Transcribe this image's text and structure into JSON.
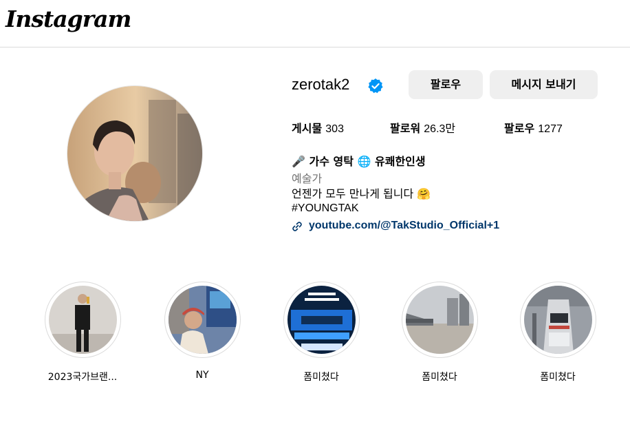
{
  "app": {
    "logo_text": "Instagram"
  },
  "profile": {
    "username": "zerotak2",
    "follow_label": "팔로우",
    "message_label": "메시지 보내기",
    "stats": [
      {
        "label": "게시물",
        "value": "303"
      },
      {
        "label": "팔로워",
        "value": "26.3만"
      },
      {
        "label": "팔로우",
        "value": "1277"
      }
    ],
    "bio": {
      "name": "🎤 가수 영탁 🌐 유쾌한인생",
      "category": "예술가",
      "line1": "언젠가 모두 만나게 됩니다 🤗",
      "hashtag": "#YOUNGTAK",
      "link": "youtube.com/@TakStudio_Official+1"
    }
  },
  "highlights": [
    {
      "label": "2023국가브랜..."
    },
    {
      "label": "NY"
    },
    {
      "label": "폼미쳤다"
    },
    {
      "label": "폼미쳤다"
    },
    {
      "label": "폼미쳤다"
    }
  ],
  "colors": {
    "verified": "#0095f6",
    "link": "#00376b",
    "button_bg": "#efefef",
    "border": "#dbdbdb"
  }
}
